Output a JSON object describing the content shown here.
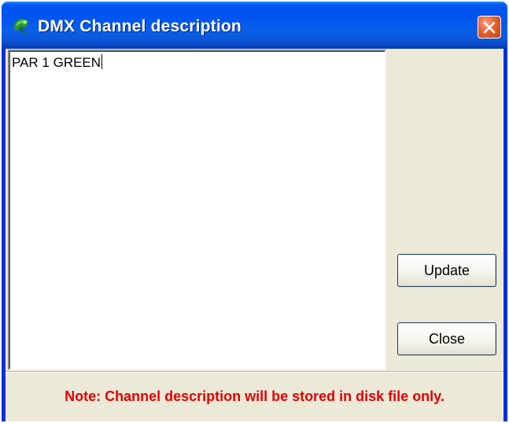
{
  "window": {
    "title": "DMX Channel description",
    "icon": "green-leaf-app-icon",
    "close_icon": "close-x-icon"
  },
  "editor": {
    "value": "PAR 1 GREEN"
  },
  "buttons": {
    "update_label": "Update",
    "close_label": "Close"
  },
  "note": "Note: Channel description will be stored in disk file only.",
  "colors": {
    "titlebar": "#0058ee",
    "close_button": "#e5602f",
    "dialog_background": "#ece9d8",
    "note_text": "#e60000"
  }
}
